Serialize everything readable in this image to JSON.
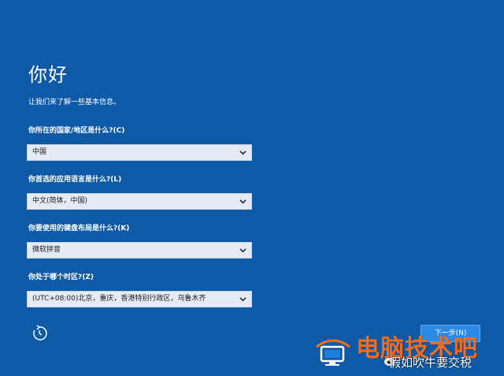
{
  "setup": {
    "title": "你好",
    "subtitle": "让我们来了解一些基本信息。",
    "fields": [
      {
        "label": "你所在的国家/地区是什么?(C)",
        "value": "中国"
      },
      {
        "label": "你首选的应用语言是什么?(L)",
        "value": "中文(简体，中国)"
      },
      {
        "label": "你要使用的键盘布局是什么?(K)",
        "value": "微软拼音"
      },
      {
        "label": "你处于哪个时区?(Z)",
        "value": "(UTC+08:00)北京，重庆，香港特别行政区，乌鲁木齐"
      }
    ],
    "next_label": "下一步(N)"
  },
  "watermark": {
    "brand_text": "电脑技术吧",
    "social_text": "假如吹牛要交税"
  },
  "icons": {
    "restart": "restart-icon",
    "chevron": "chevron-down-icon",
    "brand_logo": "computer-logo-icon",
    "weibo": "weibo-icon"
  },
  "colors": {
    "background": "#0f5aa6",
    "field_background": "#e5ebf4",
    "button": "#2a8ae6",
    "watermark_accent": "#f26c1a"
  }
}
